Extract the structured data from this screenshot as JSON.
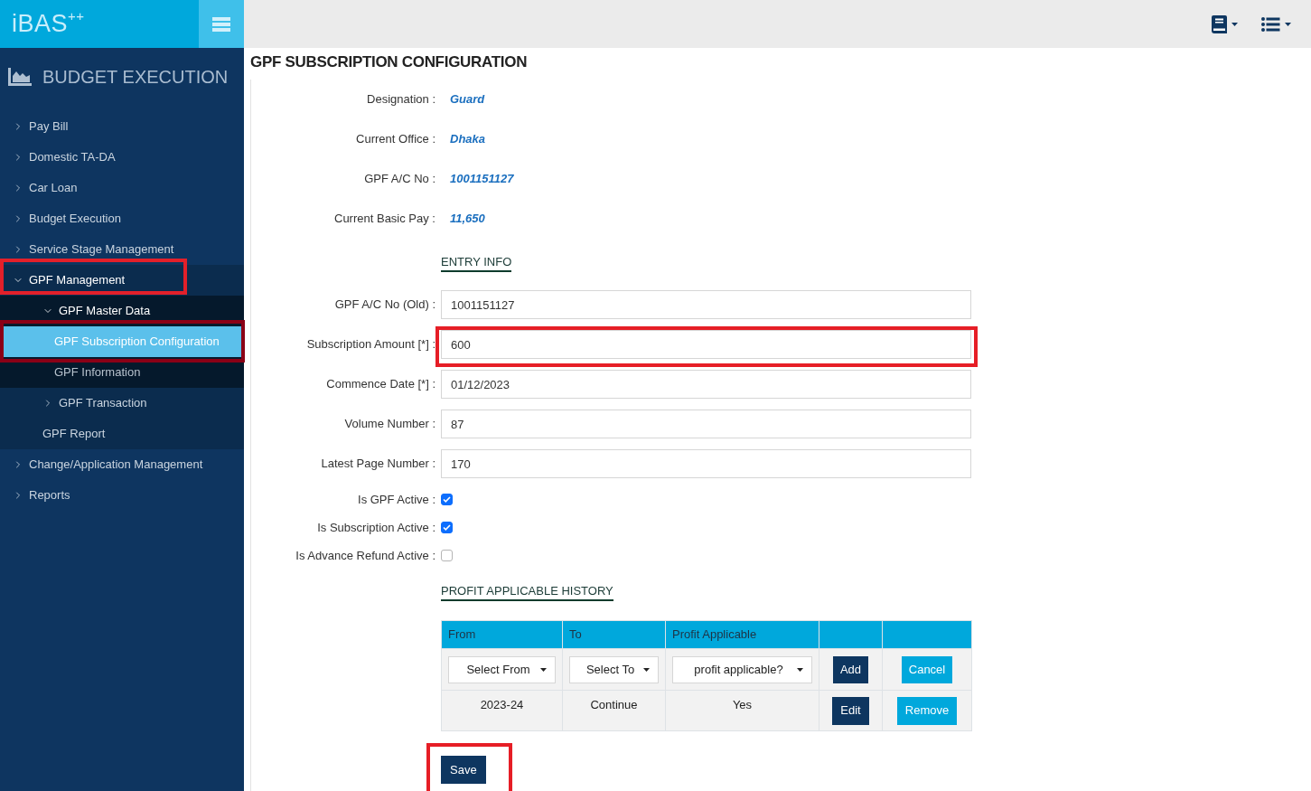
{
  "header": {
    "logo": "iBAS$^{++}$"
  },
  "sidebar": {
    "module_title": "BUDGET EXECUTION",
    "items": [
      {
        "label": "Pay Bill",
        "kind": "group",
        "expanded": false,
        "selected": false
      },
      {
        "label": "Domestic TA-DA",
        "kind": "group",
        "expanded": false,
        "selected": false
      },
      {
        "label": "Car Loan",
        "kind": "group",
        "expanded": false,
        "selected": false
      },
      {
        "label": "Budget Execution",
        "kind": "group",
        "expanded": false,
        "selected": false
      },
      {
        "label": "Service Stage Management",
        "kind": "group",
        "expanded": false,
        "selected": false
      },
      {
        "label": "GPF Management",
        "kind": "group",
        "expanded": true,
        "selected": false,
        "highlight": {
          "color": "#e3202a"
        },
        "children": [
          {
            "label": "GPF Master Data",
            "kind": "group",
            "expanded": true,
            "selected": false,
            "children": [
              {
                "label": "GPF Subscription Configuration",
                "kind": "link",
                "selected": true,
                "highlight": {
                  "color": "#8b0016"
                }
              },
              {
                "label": "GPF Information",
                "kind": "link",
                "selected": false
              }
            ]
          },
          {
            "label": "GPF Transaction",
            "kind": "group",
            "expanded": false,
            "selected": false
          },
          {
            "label": "GPF Report",
            "kind": "link",
            "selected": false
          }
        ]
      },
      {
        "label": "Change/Application Management",
        "kind": "group",
        "expanded": false,
        "selected": false
      },
      {
        "label": "Reports",
        "kind": "group",
        "expanded": false,
        "selected": false
      }
    ]
  },
  "page": {
    "title": "GPF SUBSCRIPTION CONFIGURATION",
    "details": [
      {
        "label": "Designation :",
        "value": "Guard"
      },
      {
        "label": "Current Office :",
        "value": "Dhaka"
      },
      {
        "label": "GPF A/C No :",
        "value": "1001151127"
      },
      {
        "label": "Current Basic Pay :",
        "value": "11,650"
      }
    ],
    "entry_info": {
      "heading": "ENTRY INFO",
      "fields": [
        {
          "label": "GPF A/C No (Old) :",
          "value": "1001151127"
        },
        {
          "label": "Subscription Amount [*] :",
          "value": "600",
          "highlight": {
            "color": "#e61e26"
          }
        },
        {
          "label": "Commence Date [*] :",
          "value": "01/12/2023"
        },
        {
          "label": "Volume Number :",
          "value": "87"
        },
        {
          "label": "Latest Page Number :",
          "value": "170"
        }
      ],
      "checkboxes": [
        {
          "label": "Is GPF Active :",
          "checked": true
        },
        {
          "label": "Is Subscription Active :",
          "checked": true
        },
        {
          "label": "Is Advance Refund Active :",
          "checked": false
        }
      ]
    },
    "profit_history": {
      "heading": "PROFIT APPLICABLE HISTORY",
      "columns": [
        "From",
        "To",
        "Profit Applicable"
      ],
      "entry_row": {
        "selects": [
          {
            "placeholder": "Select From"
          },
          {
            "placeholder": "Select To"
          },
          {
            "placeholder": "profit applicable?"
          }
        ],
        "actions": [
          {
            "label": "Add",
            "kind": "primary"
          },
          {
            "label": "Cancel",
            "kind": "secondary"
          }
        ]
      },
      "rows": [
        {
          "cells": [
            "2023-24",
            "Continue",
            "Yes"
          ],
          "actions": [
            {
              "label": "Edit",
              "kind": "primary"
            },
            {
              "label": "Remove",
              "kind": "secondary"
            }
          ]
        }
      ]
    },
    "save_button": {
      "label": "Save",
      "highlight": {
        "color": "#e61e26"
      }
    }
  }
}
